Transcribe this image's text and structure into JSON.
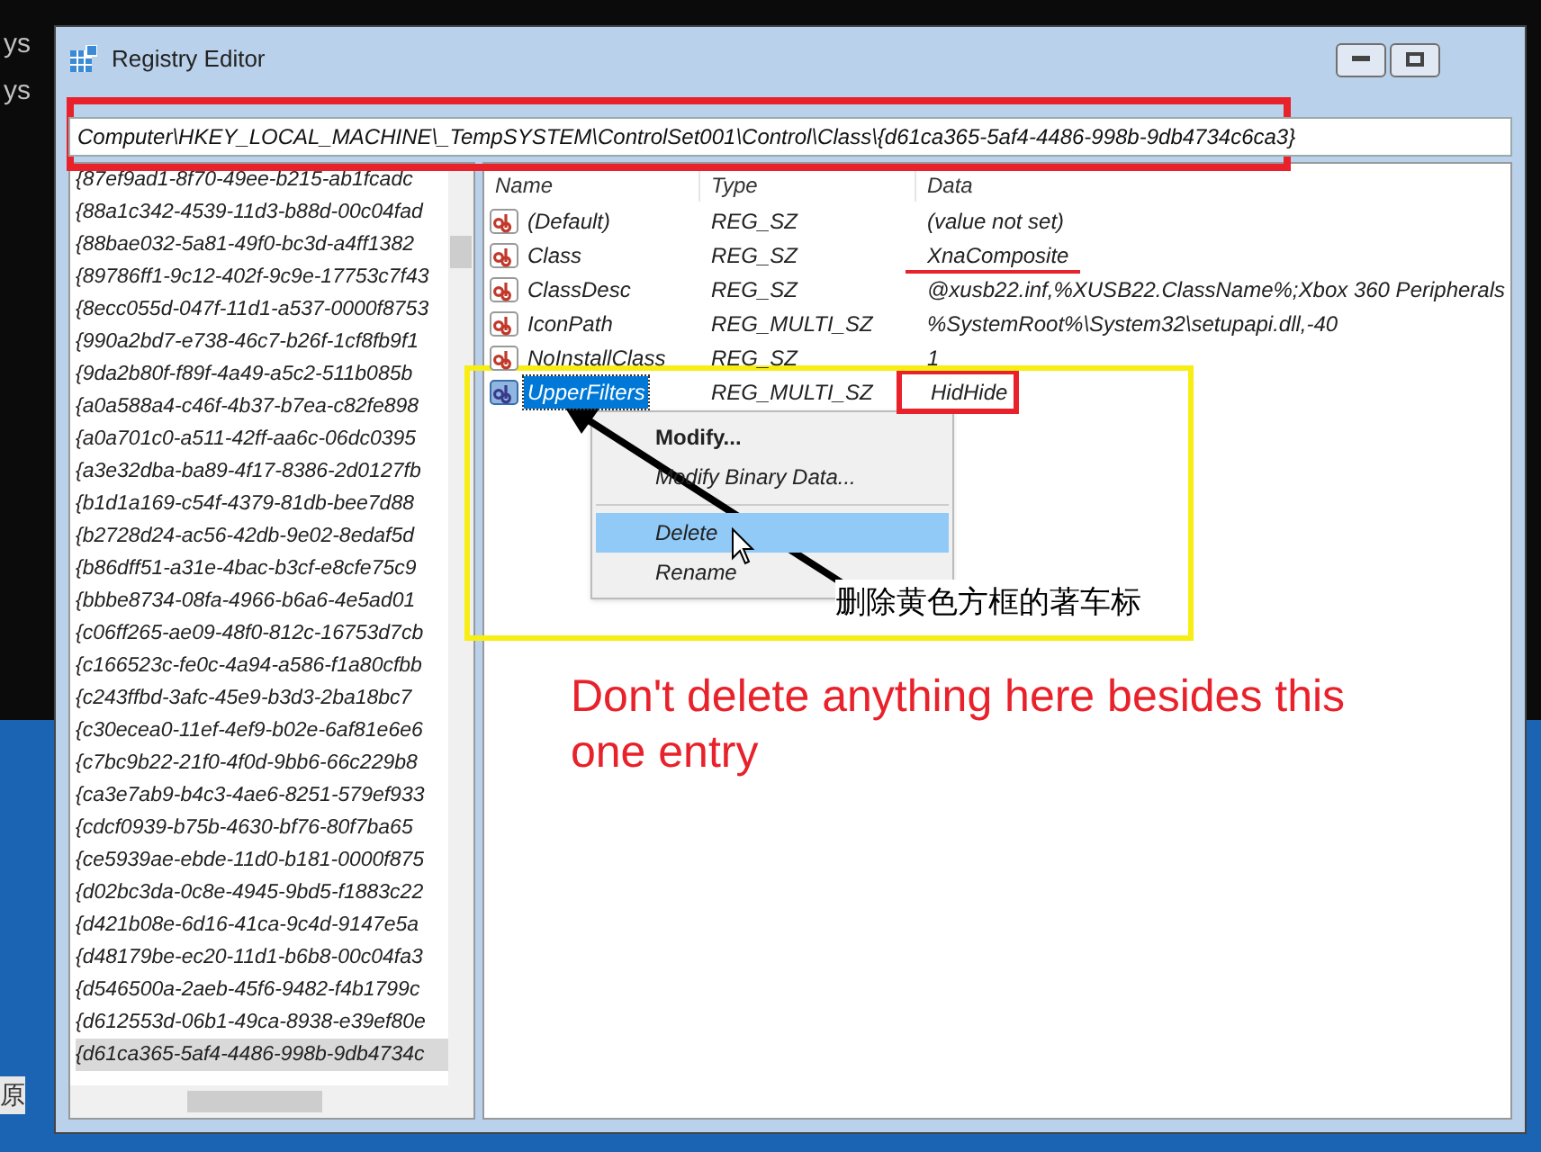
{
  "background_text": [
    "ys",
    "ys",
    "原"
  ],
  "window": {
    "title": "Registry Editor"
  },
  "address": "Computer\\HKEY_LOCAL_MACHINE\\_TempSYSTEM\\ControlSet001\\Control\\Class\\{d61ca365-5af4-4486-998b-9db4734c6ca3}",
  "tree": [
    {
      "label": "{87ef9ad1-8f70-49ee-b215-ab1fcadc",
      "selected": false
    },
    {
      "label": "{88a1c342-4539-11d3-b88d-00c04fad",
      "selected": false
    },
    {
      "label": "{88bae032-5a81-49f0-bc3d-a4ff1382",
      "selected": false
    },
    {
      "label": "{89786ff1-9c12-402f-9c9e-17753c7f43",
      "selected": false
    },
    {
      "label": "{8ecc055d-047f-11d1-a537-0000f8753",
      "selected": false
    },
    {
      "label": "{990a2bd7-e738-46c7-b26f-1cf8fb9f1",
      "selected": false
    },
    {
      "label": "{9da2b80f-f89f-4a49-a5c2-511b085b",
      "selected": false
    },
    {
      "label": "{a0a588a4-c46f-4b37-b7ea-c82fe898",
      "selected": false
    },
    {
      "label": "{a0a701c0-a511-42ff-aa6c-06dc0395",
      "selected": false
    },
    {
      "label": "{a3e32dba-ba89-4f17-8386-2d0127fb",
      "selected": false
    },
    {
      "label": "{b1d1a169-c54f-4379-81db-bee7d88",
      "selected": false
    },
    {
      "label": "{b2728d24-ac56-42db-9e02-8edaf5d",
      "selected": false
    },
    {
      "label": "{b86dff51-a31e-4bac-b3cf-e8cfe75c9",
      "selected": false
    },
    {
      "label": "{bbbe8734-08fa-4966-b6a6-4e5ad01",
      "selected": false
    },
    {
      "label": "{c06ff265-ae09-48f0-812c-16753d7cb",
      "selected": false
    },
    {
      "label": "{c166523c-fe0c-4a94-a586-f1a80cfbb",
      "selected": false
    },
    {
      "label": "{c243ffbd-3afc-45e9-b3d3-2ba18bc7",
      "selected": false
    },
    {
      "label": "{c30ecea0-11ef-4ef9-b02e-6af81e6e6",
      "selected": false
    },
    {
      "label": "{c7bc9b22-21f0-4f0d-9bb6-66c229b8",
      "selected": false
    },
    {
      "label": "{ca3e7ab9-b4c3-4ae6-8251-579ef933",
      "selected": false
    },
    {
      "label": "{cdcf0939-b75b-4630-bf76-80f7ba65",
      "selected": false
    },
    {
      "label": "{ce5939ae-ebde-11d0-b181-0000f875",
      "selected": false
    },
    {
      "label": "{d02bc3da-0c8e-4945-9bd5-f1883c22",
      "selected": false
    },
    {
      "label": "{d421b08e-6d16-41ca-9c4d-9147e5a",
      "selected": false
    },
    {
      "label": "{d48179be-ec20-11d1-b6b8-00c04fa3",
      "selected": false
    },
    {
      "label": "{d546500a-2aeb-45f6-9482-f4b1799c",
      "selected": false
    },
    {
      "label": "{d612553d-06b1-49ca-8938-e39ef80e",
      "selected": false
    },
    {
      "label": "{d61ca365-5af4-4486-998b-9db4734c",
      "selected": true
    }
  ],
  "table": {
    "columns": [
      "Name",
      "Type",
      "Data"
    ],
    "rows": [
      {
        "name": "(Default)",
        "type": "REG_SZ",
        "data": "(value not set)",
        "selected": false,
        "highlighted": false
      },
      {
        "name": "Class",
        "type": "REG_SZ",
        "data": "XnaComposite",
        "selected": false,
        "highlighted": false
      },
      {
        "name": "ClassDesc",
        "type": "REG_SZ",
        "data": "@xusb22.inf,%XUSB22.ClassName%;Xbox 360 Peripherals",
        "selected": false,
        "highlighted": false
      },
      {
        "name": "IconPath",
        "type": "REG_MULTI_SZ",
        "data": "%SystemRoot%\\System32\\setupapi.dll,-40",
        "selected": false,
        "highlighted": false
      },
      {
        "name": "NoInstallClass",
        "type": "REG_SZ",
        "data": "1",
        "selected": false,
        "highlighted": false
      },
      {
        "name": "UpperFilters",
        "type": "REG_MULTI_SZ",
        "data": "HidHide",
        "selected": true,
        "highlighted": true
      }
    ]
  },
  "context_menu": [
    {
      "label": "Modify...",
      "kind": "default",
      "selected": false
    },
    {
      "label": "Modify Binary Data...",
      "kind": "item",
      "selected": false
    },
    {
      "kind": "separator"
    },
    {
      "label": "Delete",
      "kind": "item",
      "selected": true
    },
    {
      "label": "Rename",
      "kind": "item",
      "selected": false
    }
  ],
  "annotations": {
    "arrow_note": "删除黄色方框的著车标",
    "warning": "Don't delete anything here besides this one entry"
  }
}
